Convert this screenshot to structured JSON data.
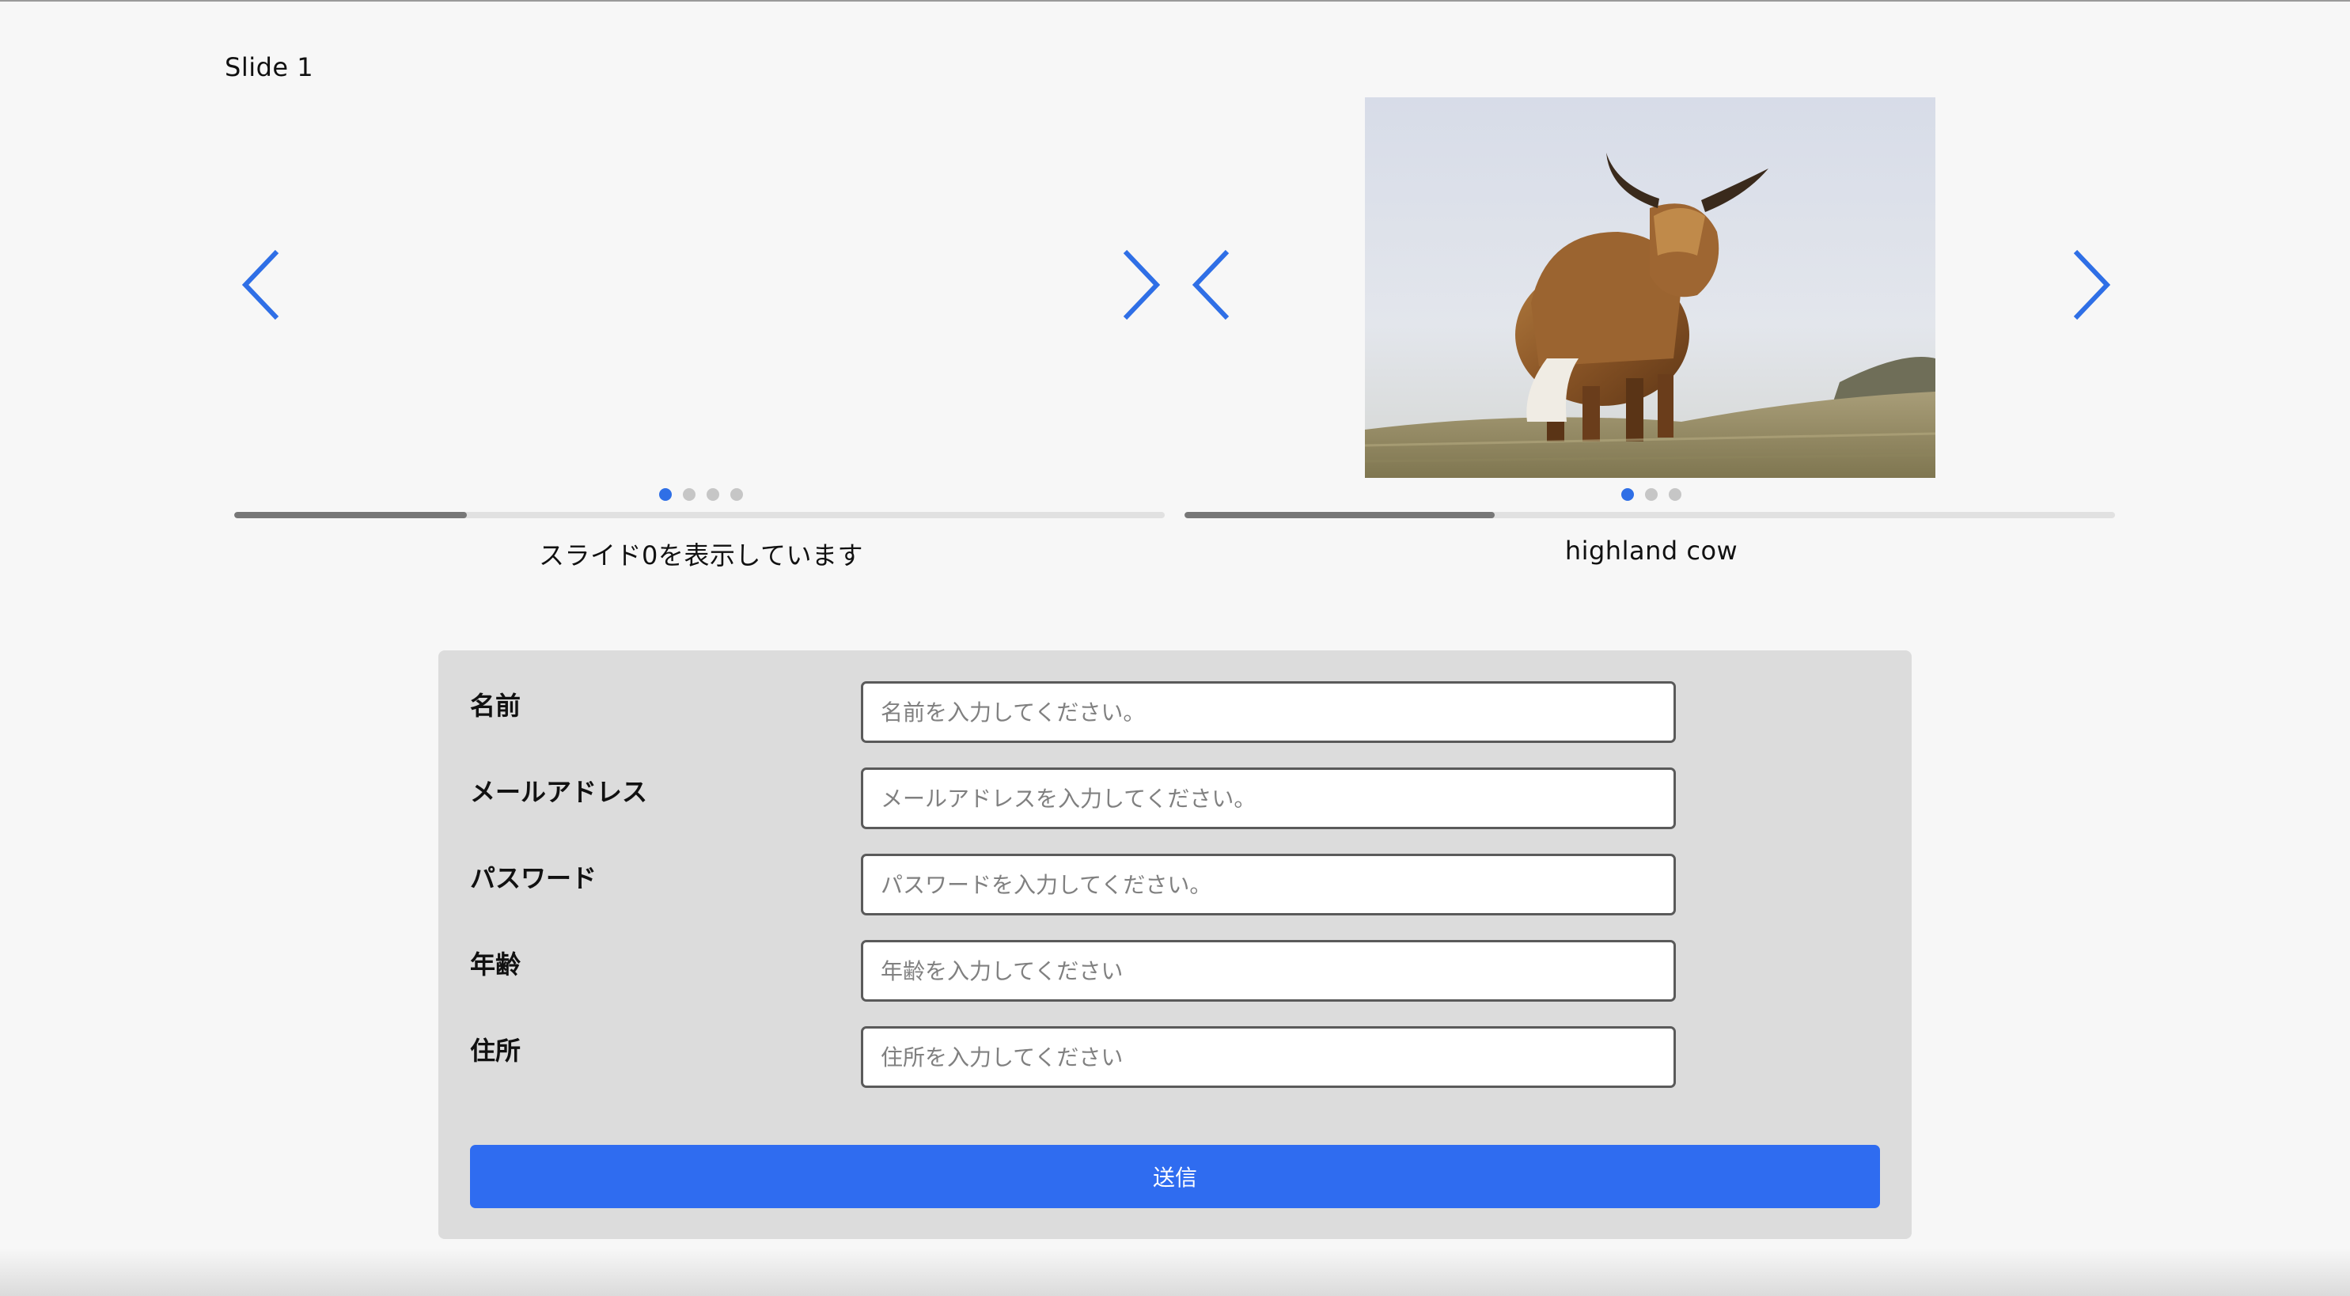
{
  "slide_label": "Slide 1",
  "accent_color": "#2f6fe6",
  "carousels": [
    {
      "caption": "スライド0を表示しています",
      "dot_count": 4,
      "active_dot": 0,
      "progress_fraction": 0.25,
      "image": null
    },
    {
      "caption": "highland cow",
      "dot_count": 3,
      "active_dot": 0,
      "progress_fraction": 0.333,
      "image": "highland-cow-photo"
    }
  ],
  "form": {
    "fields": [
      {
        "label": "名前",
        "placeholder": "名前を入力してください。",
        "value": ""
      },
      {
        "label": "メールアドレス",
        "placeholder": "メールアドレスを入力してください。",
        "value": ""
      },
      {
        "label": "パスワード",
        "placeholder": "パスワードを入力してください。",
        "value": ""
      },
      {
        "label": "年齢",
        "placeholder": "年齢を入力してください",
        "value": ""
      },
      {
        "label": "住所",
        "placeholder": "住所を入力してください",
        "value": ""
      }
    ],
    "submit_label": "送信",
    "submit_color": "#2f6cf0"
  }
}
